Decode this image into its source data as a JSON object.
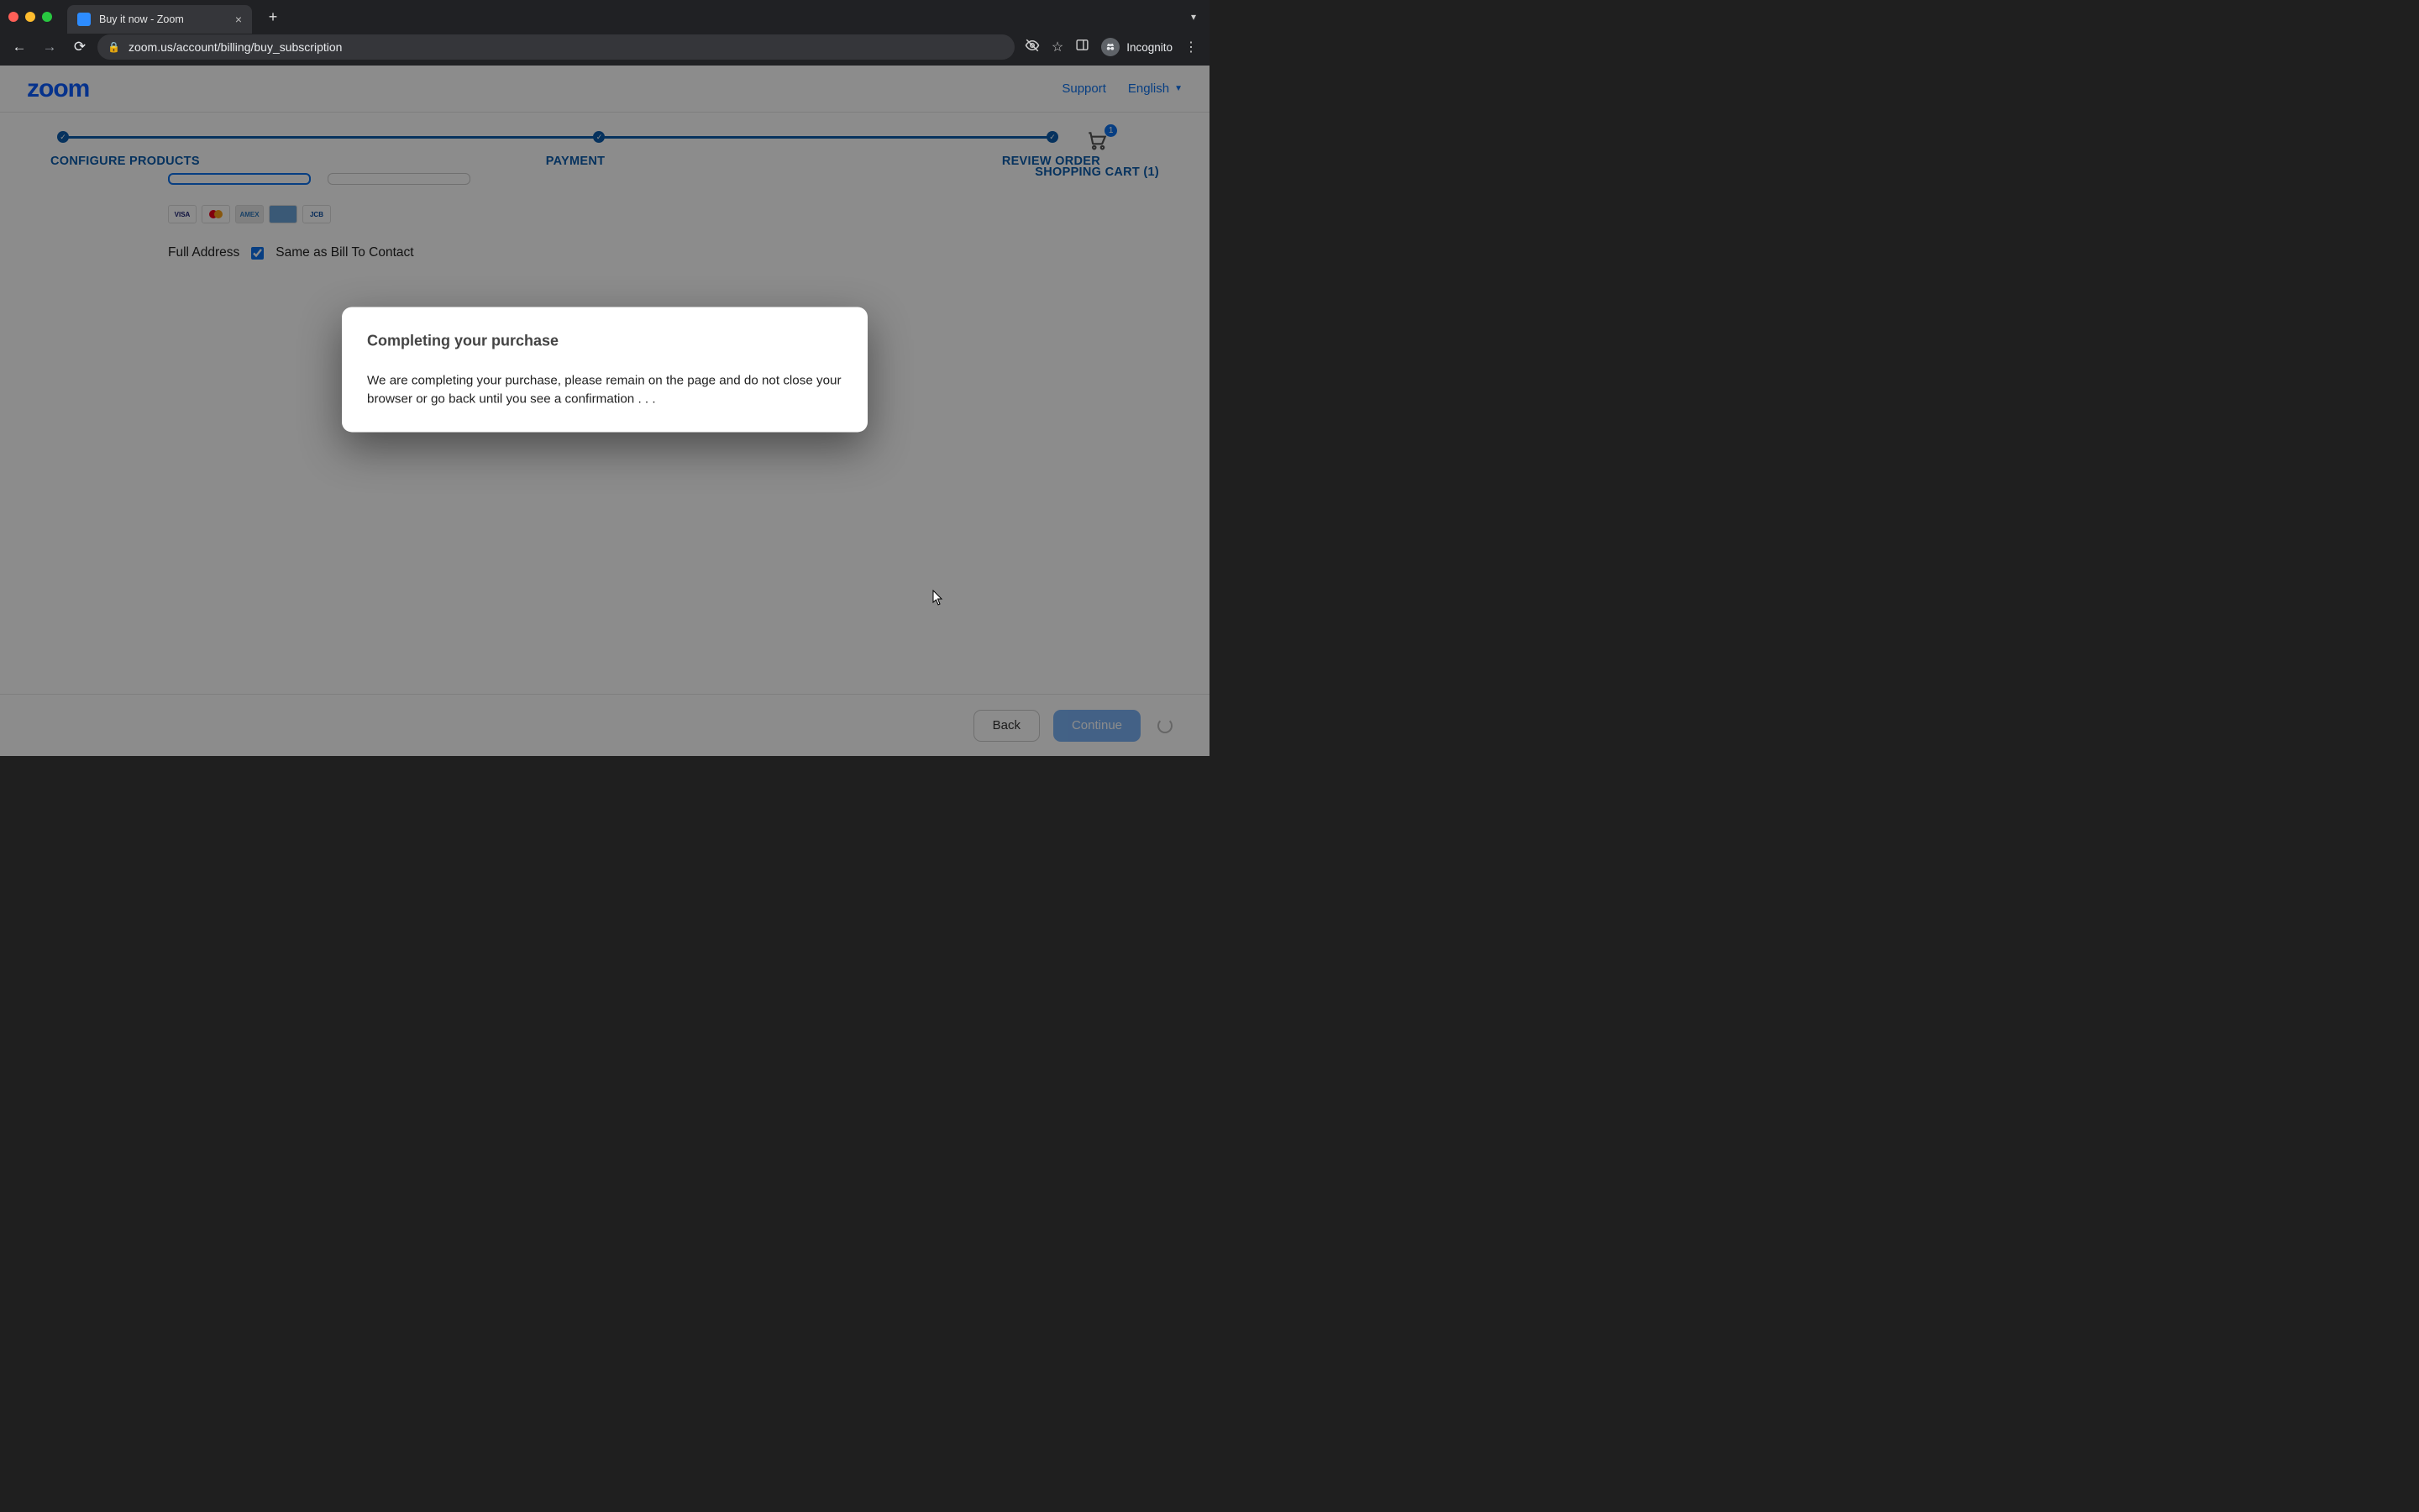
{
  "browser": {
    "tab_title": "Buy it now - Zoom",
    "url": "zoom.us/account/billing/buy_subscription",
    "incognito_label": "Incognito"
  },
  "header": {
    "logo_text": "zoom",
    "support_label": "Support",
    "language_label": "English"
  },
  "steps": {
    "s1": "CONFIGURE PRODUCTS",
    "s2": "PAYMENT",
    "s3": "REVIEW ORDER"
  },
  "cart": {
    "label": "SHOPPING CART (1)",
    "count": "1"
  },
  "payment": {
    "cards": {
      "visa": "VISA",
      "amex": "AMEX",
      "jcb": "JCB"
    },
    "full_address_label": "Full Address",
    "same_as_label": "Same as Bill To Contact",
    "same_as_checked": true
  },
  "footer": {
    "back": "Back",
    "continue": "Continue"
  },
  "modal": {
    "title": "Completing your purchase",
    "body": "We are completing your purchase, please remain on the page and do not close your browser or go back until you see a confirmation . . ."
  }
}
